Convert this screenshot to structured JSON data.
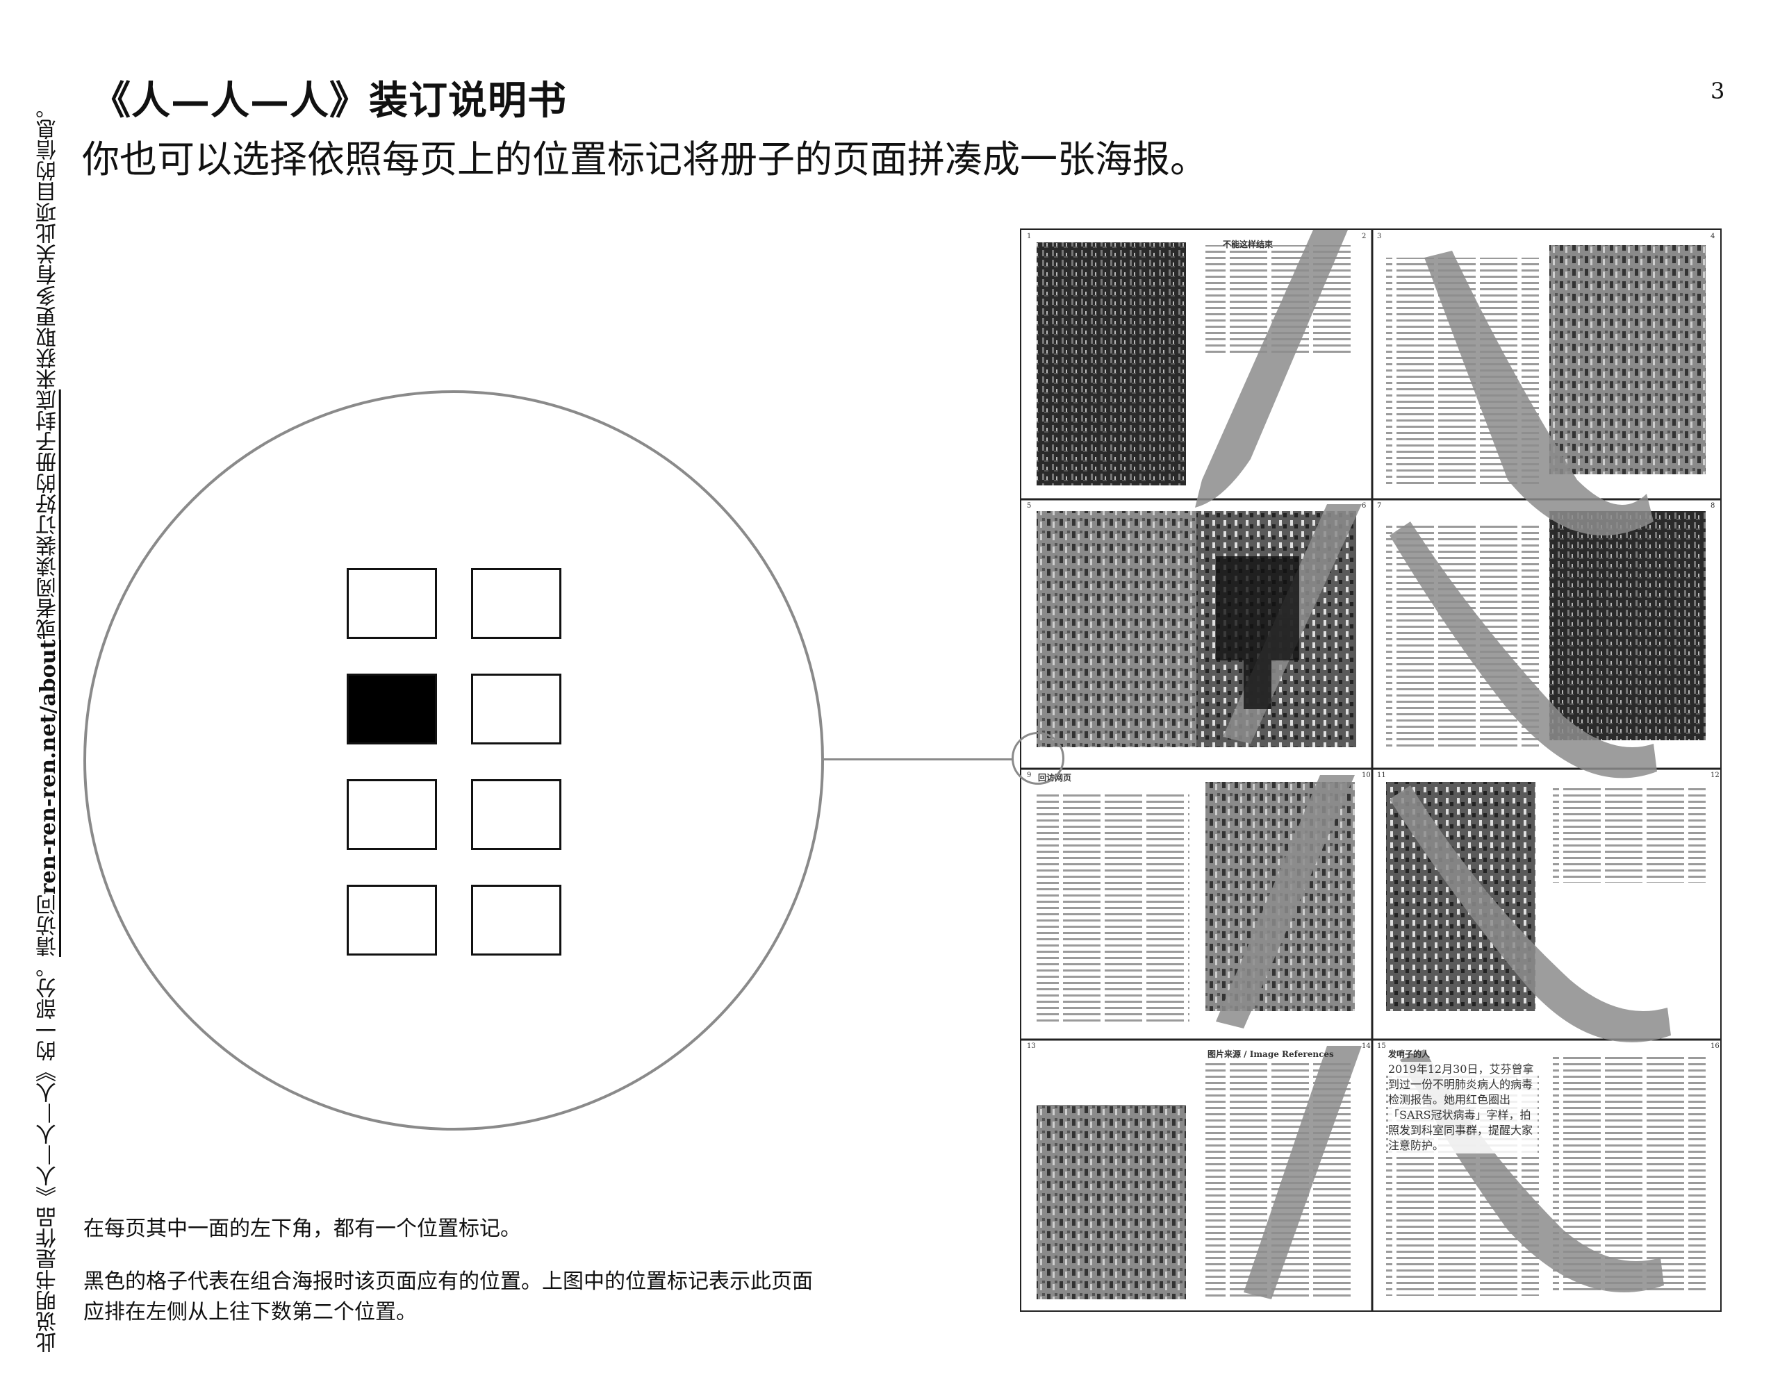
{
  "header": {
    "title": "《人—人—人》装订说明书",
    "subtitle": "你也可以选择依照每页上的位置标记将册子的页面拼凑成一张海报。",
    "page_number": "3"
  },
  "side_note": {
    "prefix": "此说明书是作品《人—人—人》的一部分。",
    "visit": "请访问",
    "url": "ren-ren-ren.net/about",
    "suffix_underlined": "或者阅读装订好的册子封底",
    "suffix": "来获取更多有关此项目的信息。"
  },
  "position_marker": {
    "rows": 4,
    "cols": 2,
    "filled_cell": {
      "row": 2,
      "col": 1
    }
  },
  "poster": {
    "page_numbers": [
      "1",
      "2",
      "3",
      "4",
      "5",
      "6",
      "7",
      "8",
      "9",
      "10",
      "11",
      "12",
      "13",
      "14",
      "15",
      "16"
    ],
    "headings": {
      "top_right": "不能这样结束",
      "mid_left": "回访网页",
      "bottom_mid": "图片来源 / Image References",
      "bottom_right": "发哨子的人"
    },
    "bottom_right_lead": "2019年12月30日，艾芬曾拿到过一份不明肺炎病人的病毒检测报告。她用红色圈出「SARS冠状病毒」字样，拍照发到科室同事群，提醒大家注意防护。",
    "colors": {
      "ink": "#111111",
      "gray_overlay": "#8c8c8c",
      "line": "#8a8a8a"
    }
  },
  "instructions": {
    "para1": "在每页其中一面的左下角，都有一个位置标记。",
    "para2": "黑色的格子代表在组合海报时该页面应有的位置。上图中的位置标记表示此页面应排在左侧从上往下数第二个位置。"
  }
}
